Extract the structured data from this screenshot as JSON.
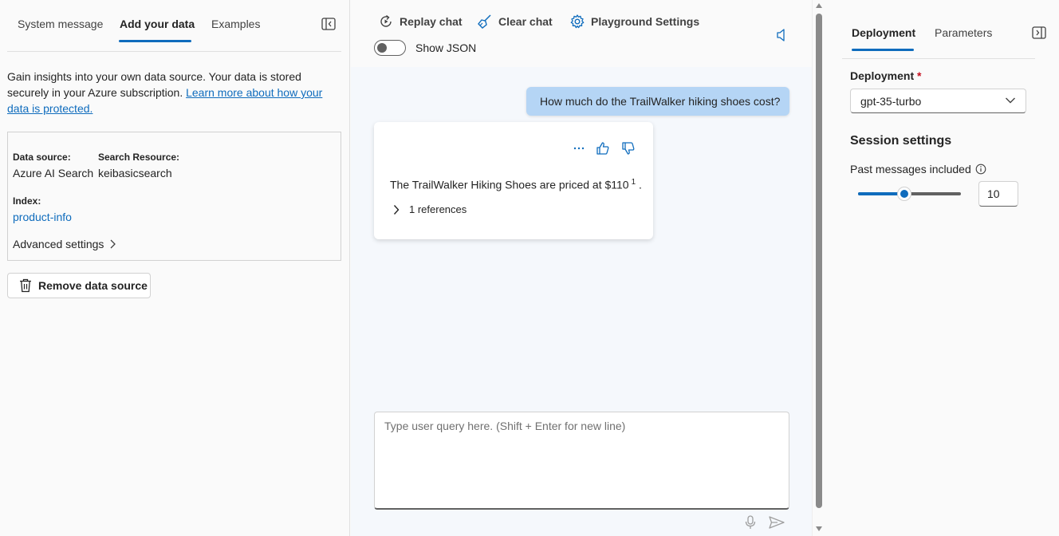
{
  "left": {
    "tabs": [
      {
        "label": "System message"
      },
      {
        "label": "Add your data"
      },
      {
        "label": "Examples"
      }
    ],
    "intro_text": "Gain insights into your own data source. Your data is stored securely in your Azure subscription. ",
    "intro_link": "Learn more about how your data is protected.",
    "data_source_label": "Data source:",
    "data_source_value": "Azure AI Search",
    "search_resource_label": "Search Resource:",
    "search_resource_value": "keibasicsearch",
    "index_label": "Index:",
    "index_value": "product-info",
    "advanced_settings": "Advanced settings",
    "remove_button": "Remove data source"
  },
  "toolbar": {
    "replay": "Replay chat",
    "clear": "Clear chat",
    "settings": "Playground Settings",
    "show_json": "Show JSON",
    "show_json_on": false
  },
  "chat": {
    "user_message": "How much do the TrailWalker hiking shoes cost?",
    "reply_text": "The TrailWalker Hiking Shoes are priced at $110",
    "citation": "1",
    "reply_end": ".",
    "references": "1 references",
    "composer_placeholder": "Type user query here. (Shift + Enter for new line)"
  },
  "right": {
    "tabs": [
      {
        "label": "Deployment"
      },
      {
        "label": "Parameters"
      }
    ],
    "deployment_label": "Deployment",
    "required_mark": "*",
    "deployment_value": "gpt-35-turbo",
    "session_title": "Session settings",
    "past_messages_label": "Past messages included",
    "past_messages_value": "10",
    "past_messages_slider_fraction": 0.45
  },
  "colors": {
    "accent": "#0f6cbd",
    "user_bubble": "#b5d5f5",
    "required": "#c50f1f"
  }
}
